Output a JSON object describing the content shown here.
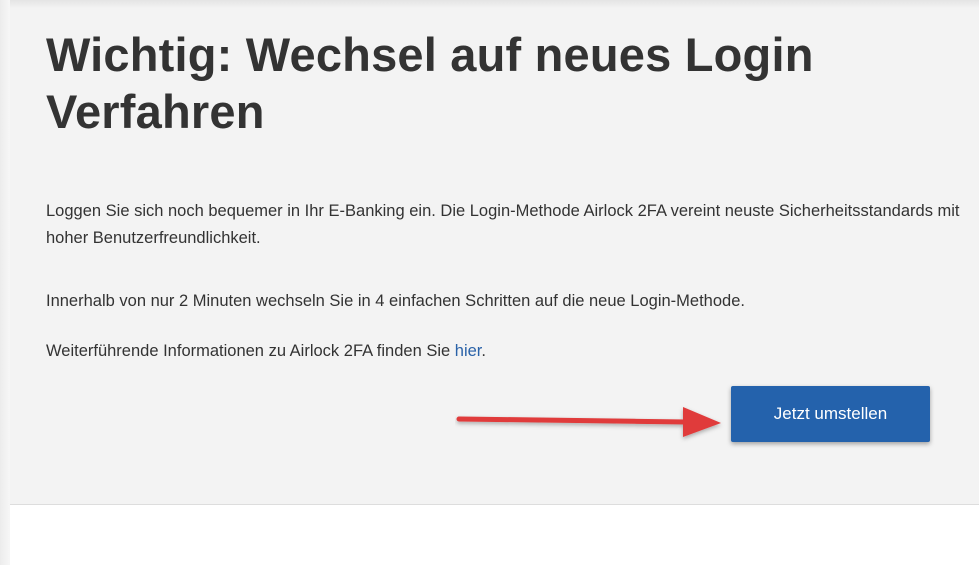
{
  "notice": {
    "title": "Wichtig: Wechsel auf neues Login Verfahren",
    "paragraph_1": "Loggen Sie sich noch bequemer in Ihr E-Banking ein. Die Login-Methode Airlock 2FA vereint neuste Sicherheitsstandards mit hoher Benutzerfreundlichkeit.",
    "paragraph_2": "Innerhalb von nur 2 Minuten wechseln Sie in 4 einfachen Schritten auf die neue Login-Methode.",
    "paragraph_3_text": "Weiterführende Informationen zu Airlock 2FA finden Sie ",
    "paragraph_3_link": "hier",
    "paragraph_3_end": "."
  },
  "action": {
    "button_label": "Jetzt umstellen"
  },
  "annotation": {
    "arrow_icon": "right-arrow-icon",
    "arrow_color": "#e03a3a"
  },
  "colors": {
    "panel_bg": "#f3f3f3",
    "text": "#333333",
    "link": "#2a62a8",
    "button_bg": "#2462ac"
  }
}
